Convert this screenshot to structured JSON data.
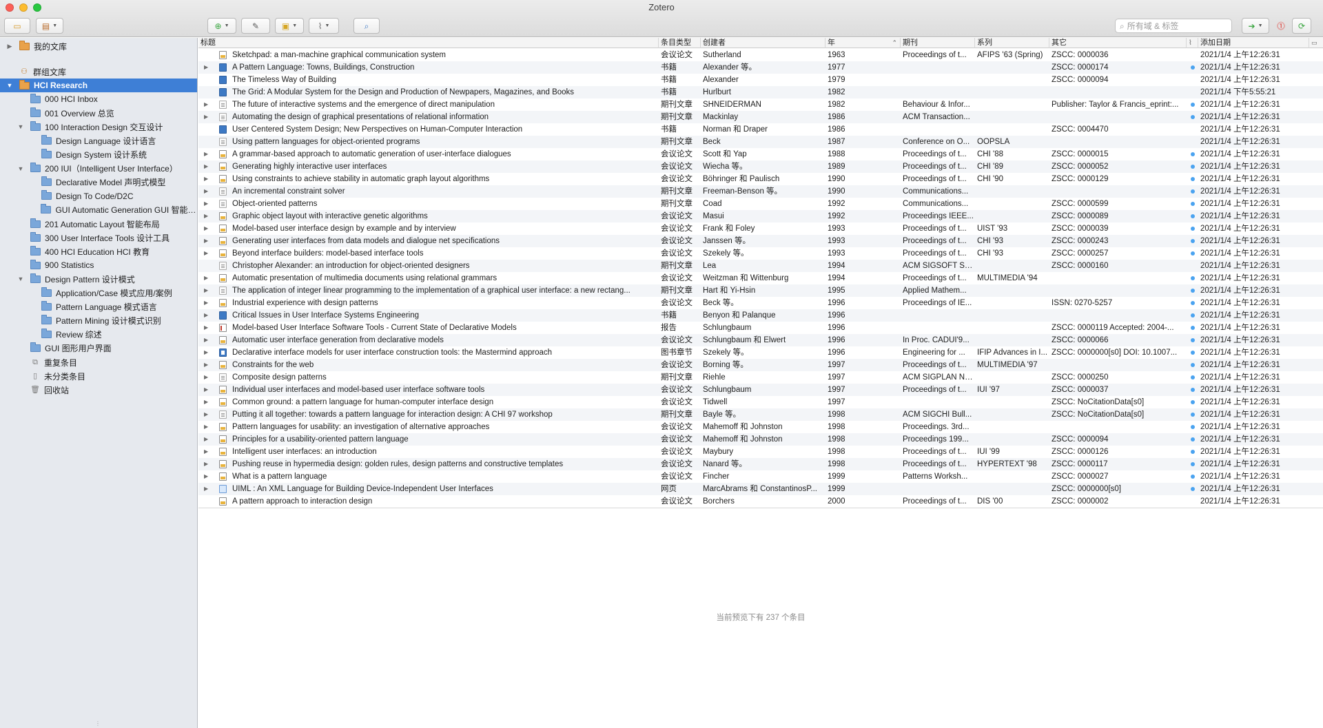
{
  "window": {
    "title": "Zotero"
  },
  "toolbar": {
    "search_placeholder": "所有域 & 标签",
    "search_value": ""
  },
  "sidebar": {
    "items": [
      {
        "label": "我的文库",
        "indent": 0,
        "twisty": "▶",
        "icon": "library-icon",
        "orange": true
      },
      {
        "label": "群组文库",
        "indent": 0,
        "twisty": "",
        "icon": "group-library-icon",
        "group": true
      },
      {
        "label": "HCI Research",
        "indent": 0,
        "twisty": "▼",
        "icon": "group-folder-icon",
        "orange": true,
        "selected": true
      },
      {
        "label": "000 HCI Inbox",
        "indent": 1,
        "twisty": ""
      },
      {
        "label": "001 Overview 总览",
        "indent": 1,
        "twisty": ""
      },
      {
        "label": "100 Interaction Design 交互设计",
        "indent": 1,
        "twisty": "▼"
      },
      {
        "label": "Design Language 设计语言",
        "indent": 2,
        "twisty": ""
      },
      {
        "label": "Design System 设计系统",
        "indent": 2,
        "twisty": ""
      },
      {
        "label": "200 IUI（Intelligent User Interface）",
        "indent": 1,
        "twisty": "▼"
      },
      {
        "label": "Declarative Model 声明式模型",
        "indent": 2,
        "twisty": ""
      },
      {
        "label": "Design To Code/D2C",
        "indent": 2,
        "twisty": ""
      },
      {
        "label": "GUI Automatic Generation GUI 智能生成",
        "indent": 2,
        "twisty": ""
      },
      {
        "label": "201 Automatic Layout 智能布局",
        "indent": 1,
        "twisty": ""
      },
      {
        "label": "300 User Interface Tools 设计工具",
        "indent": 1,
        "twisty": ""
      },
      {
        "label": "400 HCI Education HCI 教育",
        "indent": 1,
        "twisty": ""
      },
      {
        "label": "900 Statistics",
        "indent": 1,
        "twisty": ""
      },
      {
        "label": "Design Pattern 设计模式",
        "indent": 1,
        "twisty": "▼"
      },
      {
        "label": "Application/Case 模式应用/案例",
        "indent": 2,
        "twisty": ""
      },
      {
        "label": "Pattern Language 模式语言",
        "indent": 2,
        "twisty": ""
      },
      {
        "label": "Pattern Mining 设计模式识别",
        "indent": 2,
        "twisty": ""
      },
      {
        "label": "Review 综述",
        "indent": 2,
        "twisty": ""
      },
      {
        "label": "GUI 图形用户界面",
        "indent": 1,
        "twisty": ""
      },
      {
        "label": "重复条目",
        "indent": 1,
        "twisty": "",
        "special": "duplicate-items-icon"
      },
      {
        "label": "未分类条目",
        "indent": 1,
        "twisty": "",
        "special": "unfiled-items-icon"
      },
      {
        "label": "回收站",
        "indent": 1,
        "twisty": "",
        "special": "trash-icon"
      }
    ]
  },
  "columns": {
    "title": "标题",
    "type": "条目类型",
    "creator": "创建者",
    "year": "年",
    "publication": "期刊",
    "series": "系列",
    "extra": "其它",
    "date_added": "添加日期"
  },
  "rows": [
    {
      "title": "Sketchpad: a man-machine graphical communication system",
      "type": "会议论文",
      "creator": "Sutherland",
      "year": "1963",
      "pub": "Proceedings of t...",
      "series": "AFIPS '63 (Spring)",
      "extra": "ZSCC: 0000036",
      "added": "2021/1/4 上午12:26:31",
      "icon": "conf",
      "exp": false,
      "att": false
    },
    {
      "title": "A Pattern Language: Towns, Buildings, Construction",
      "type": "书籍",
      "creator": "Alexander 等。",
      "year": "1977",
      "pub": "",
      "series": "",
      "extra": "ZSCC: 0000174",
      "added": "2021/1/4 上午12:26:31",
      "icon": "book",
      "exp": true,
      "att": true
    },
    {
      "title": "The Timeless Way of Building",
      "type": "书籍",
      "creator": "Alexander",
      "year": "1979",
      "pub": "",
      "series": "",
      "extra": "ZSCC: 0000094",
      "added": "2021/1/4 上午12:26:31",
      "icon": "book",
      "exp": false,
      "att": false
    },
    {
      "title": "The Grid: A Modular System for the Design and Production of Newpapers, Magazines, and Books",
      "type": "书籍",
      "creator": "Hurlburt",
      "year": "1982",
      "pub": "",
      "series": "",
      "extra": "",
      "added": "2021/1/4 下午5:55:21",
      "icon": "book",
      "exp": false,
      "att": false
    },
    {
      "title": "The future of interactive systems and the emergence of direct manipulation",
      "type": "期刊文章",
      "creator": "SHNEIDERMAN",
      "year": "1982",
      "pub": "Behaviour & Infor...",
      "series": "",
      "extra": "Publisher: Taylor & Francis_eprint:...",
      "added": "2021/1/4 上午12:26:31",
      "icon": "journal",
      "exp": true,
      "att": true
    },
    {
      "title": "Automating the design of graphical presentations of relational information",
      "type": "期刊文章",
      "creator": "Mackinlay",
      "year": "1986",
      "pub": "ACM Transaction...",
      "series": "",
      "extra": "",
      "added": "2021/1/4 上午12:26:31",
      "icon": "journal",
      "exp": true,
      "att": true
    },
    {
      "title": "User Centered System Design; New Perspectives on Human-Computer Interaction",
      "type": "书籍",
      "creator": "Norman 和 Draper",
      "year": "1986",
      "pub": "",
      "series": "",
      "extra": "ZSCC: 0004470",
      "added": "2021/1/4 上午12:26:31",
      "icon": "book",
      "exp": false,
      "att": false
    },
    {
      "title": "Using pattern languages for object-oriented programs",
      "type": "期刊文章",
      "creator": "Beck",
      "year": "1987",
      "pub": "Conference on O...",
      "series": "OOPSLA",
      "extra": "",
      "added": "2021/1/4 上午12:26:31",
      "icon": "journal",
      "exp": false,
      "att": false
    },
    {
      "title": "A grammar-based approach to automatic generation of user-interface dialogues",
      "type": "会议论文",
      "creator": "Scott 和 Yap",
      "year": "1988",
      "pub": "Proceedings of t...",
      "series": "CHI '88",
      "extra": "ZSCC: 0000015",
      "added": "2021/1/4 上午12:26:31",
      "icon": "conf",
      "exp": true,
      "att": true
    },
    {
      "title": "Generating highly interactive user interfaces",
      "type": "会议论文",
      "creator": "Wiecha 等。",
      "year": "1989",
      "pub": "Proceedings of t...",
      "series": "CHI '89",
      "extra": "ZSCC: 0000052",
      "added": "2021/1/4 上午12:26:31",
      "icon": "conf",
      "exp": true,
      "att": true
    },
    {
      "title": "Using constraints to achieve stability in automatic graph layout algorithms",
      "type": "会议论文",
      "creator": "Böhringer 和 Paulisch",
      "year": "1990",
      "pub": "Proceedings of t...",
      "series": "CHI '90",
      "extra": "ZSCC: 0000129",
      "added": "2021/1/4 上午12:26:31",
      "icon": "conf",
      "exp": true,
      "att": true
    },
    {
      "title": "An incremental constraint solver",
      "type": "期刊文章",
      "creator": "Freeman-Benson 等。",
      "year": "1990",
      "pub": "Communications...",
      "series": "",
      "extra": "",
      "added": "2021/1/4 上午12:26:31",
      "icon": "journal",
      "exp": true,
      "att": true
    },
    {
      "title": "Object-oriented patterns",
      "type": "期刊文章",
      "creator": "Coad",
      "year": "1992",
      "pub": "Communications...",
      "series": "",
      "extra": "ZSCC: 0000599",
      "added": "2021/1/4 上午12:26:31",
      "icon": "journal",
      "exp": true,
      "att": true
    },
    {
      "title": "Graphic object layout with interactive genetic algorithms",
      "type": "会议论文",
      "creator": "Masui",
      "year": "1992",
      "pub": "Proceedings IEEE...",
      "series": "",
      "extra": "ZSCC: 0000089",
      "added": "2021/1/4 上午12:26:31",
      "icon": "conf",
      "exp": true,
      "att": true
    },
    {
      "title": "Model-based user interface design by example and by interview",
      "type": "会议论文",
      "creator": "Frank 和 Foley",
      "year": "1993",
      "pub": "Proceedings of t...",
      "series": "UIST '93",
      "extra": "ZSCC: 0000039",
      "added": "2021/1/4 上午12:26:31",
      "icon": "conf",
      "exp": true,
      "att": true
    },
    {
      "title": "Generating user interfaces from data models and dialogue net specifications",
      "type": "会议论文",
      "creator": "Janssen 等。",
      "year": "1993",
      "pub": "Proceedings of t...",
      "series": "CHI '93",
      "extra": "ZSCC: 0000243",
      "added": "2021/1/4 上午12:26:31",
      "icon": "conf",
      "exp": true,
      "att": true
    },
    {
      "title": "Beyond interface builders: model-based interface tools",
      "type": "会议论文",
      "creator": "Szekely 等。",
      "year": "1993",
      "pub": "Proceedings of t...",
      "series": "CHI '93",
      "extra": "ZSCC: 0000257",
      "added": "2021/1/4 上午12:26:31",
      "icon": "conf",
      "exp": true,
      "att": true
    },
    {
      "title": "Christopher Alexander: an introduction for object-oriented designers",
      "type": "期刊文章",
      "creator": "Lea",
      "year": "1994",
      "pub": "ACM SIGSOFT So...",
      "series": "",
      "extra": "ZSCC: 0000160",
      "added": "2021/1/4 上午12:26:31",
      "icon": "journal",
      "exp": false,
      "att": false
    },
    {
      "title": "Automatic presentation of multimedia documents using relational grammars",
      "type": "会议论文",
      "creator": "Weitzman 和 Wittenburg",
      "year": "1994",
      "pub": "Proceedings of t...",
      "series": "MULTIMEDIA '94",
      "extra": "",
      "added": "2021/1/4 上午12:26:31",
      "icon": "conf",
      "exp": true,
      "att": true
    },
    {
      "title": "The application of integer linear programming to the implementation of a graphical user interface: a new rectang...",
      "type": "期刊文章",
      "creator": "Hart 和 Yi-Hsin",
      "year": "1995",
      "pub": "Applied Mathem...",
      "series": "",
      "extra": "",
      "added": "2021/1/4 上午12:26:31",
      "icon": "journal",
      "exp": true,
      "att": true
    },
    {
      "title": "Industrial experience with design patterns",
      "type": "会议论文",
      "creator": "Beck 等。",
      "year": "1996",
      "pub": "Proceedings of IE...",
      "series": "",
      "extra": "ISSN: 0270-5257",
      "added": "2021/1/4 上午12:26:31",
      "icon": "conf",
      "exp": true,
      "att": true
    },
    {
      "title": "Critical Issues in User Interface Systems Engineering",
      "type": "书籍",
      "creator": "Benyon 和 Palanque",
      "year": "1996",
      "pub": "",
      "series": "",
      "extra": "",
      "added": "2021/1/4 上午12:26:31",
      "icon": "book",
      "exp": true,
      "att": true
    },
    {
      "title": "Model-based User Interface Software Tools - Current State of Declarative Models",
      "type": "报告",
      "creator": "Schlungbaum",
      "year": "1996",
      "pub": "",
      "series": "",
      "extra": "ZSCC: 0000119 Accepted: 2004-...",
      "added": "2021/1/4 上午12:26:31",
      "icon": "report",
      "exp": true,
      "att": true
    },
    {
      "title": "Automatic user interface generation from declarative models",
      "type": "会议论文",
      "creator": "Schlungbaum 和 Elwert",
      "year": "1996",
      "pub": "In Proc. CADUI'9...",
      "series": "",
      "extra": "ZSCC: 0000066",
      "added": "2021/1/4 上午12:26:31",
      "icon": "conf",
      "exp": true,
      "att": true
    },
    {
      "title": "Declarative interface models for user interface construction tools: the Mastermind approach",
      "type": "图书章节",
      "creator": "Szekely 等。",
      "year": "1996",
      "pub": "Engineering for ...",
      "series": "IFIP Advances in I...",
      "extra": "ZSCC: 0000000[s0] DOI: 10.1007...",
      "added": "2021/1/4 上午12:26:31",
      "icon": "chapter",
      "exp": true,
      "att": true
    },
    {
      "title": "Constraints for the web",
      "type": "会议论文",
      "creator": "Borning 等。",
      "year": "1997",
      "pub": "Proceedings of t...",
      "series": "MULTIMEDIA '97",
      "extra": "",
      "added": "2021/1/4 上午12:26:31",
      "icon": "conf",
      "exp": true,
      "att": true
    },
    {
      "title": "Composite design patterns",
      "type": "期刊文章",
      "creator": "Riehle",
      "year": "1997",
      "pub": "ACM SIGPLAN No...",
      "series": "",
      "extra": "ZSCC: 0000250",
      "added": "2021/1/4 上午12:26:31",
      "icon": "journal",
      "exp": true,
      "att": true
    },
    {
      "title": "Individual user interfaces and model-based user interface software tools",
      "type": "会议论文",
      "creator": "Schlungbaum",
      "year": "1997",
      "pub": "Proceedings of t...",
      "series": "IUI '97",
      "extra": "ZSCC: 0000037",
      "added": "2021/1/4 上午12:26:31",
      "icon": "conf",
      "exp": true,
      "att": true
    },
    {
      "title": "Common ground: a pattern language for human-computer interface design",
      "type": "会议论文",
      "creator": "Tidwell",
      "year": "1997",
      "pub": "",
      "series": "",
      "extra": "ZSCC: NoCitationData[s0]",
      "added": "2021/1/4 上午12:26:31",
      "icon": "conf",
      "exp": true,
      "att": true
    },
    {
      "title": "Putting it all together: towards a pattern language for interaction design: A CHI 97 workshop",
      "type": "期刊文章",
      "creator": "Bayle 等。",
      "year": "1998",
      "pub": "ACM SIGCHI Bull...",
      "series": "",
      "extra": "ZSCC: NoCitationData[s0]",
      "added": "2021/1/4 上午12:26:31",
      "icon": "journal",
      "exp": true,
      "att": true
    },
    {
      "title": "Pattern languages for usability: an investigation of alternative approaches",
      "type": "会议论文",
      "creator": "Mahemoff 和 Johnston",
      "year": "1998",
      "pub": "Proceedings. 3rd...",
      "series": "",
      "extra": "",
      "added": "2021/1/4 上午12:26:31",
      "icon": "conf",
      "exp": true,
      "att": true
    },
    {
      "title": "Principles for a usability-oriented pattern language",
      "type": "会议论文",
      "creator": "Mahemoff 和 Johnston",
      "year": "1998",
      "pub": "Proceedings 199...",
      "series": "",
      "extra": "ZSCC: 0000094",
      "added": "2021/1/4 上午12:26:31",
      "icon": "conf",
      "exp": true,
      "att": true
    },
    {
      "title": "Intelligent user interfaces: an introduction",
      "type": "会议论文",
      "creator": "Maybury",
      "year": "1998",
      "pub": "Proceedings of t...",
      "series": "IUI '99",
      "extra": "ZSCC: 0000126",
      "added": "2021/1/4 上午12:26:31",
      "icon": "conf",
      "exp": true,
      "att": true
    },
    {
      "title": "Pushing reuse in hypermedia design: golden rules, design patterns and constructive templates",
      "type": "会议论文",
      "creator": "Nanard 等。",
      "year": "1998",
      "pub": "Proceedings of t...",
      "series": "HYPERTEXT '98",
      "extra": "ZSCC: 0000117",
      "added": "2021/1/4 上午12:26:31",
      "icon": "conf",
      "exp": true,
      "att": true
    },
    {
      "title": "What is a pattern language",
      "type": "会议论文",
      "creator": "Fincher",
      "year": "1999",
      "pub": "Patterns Worksh...",
      "series": "",
      "extra": "ZSCC: 0000027",
      "added": "2021/1/4 上午12:26:31",
      "icon": "conf",
      "exp": true,
      "att": true
    },
    {
      "title": "UIML : An XML Language for Building Device-Independent User Interfaces",
      "type": "网页",
      "creator": "MarcAbrams 和 ConstantinosP...",
      "year": "1999",
      "pub": "",
      "series": "",
      "extra": "ZSCC: 0000000[s0]",
      "added": "2021/1/4 上午12:26:31",
      "icon": "web",
      "exp": true,
      "att": true
    },
    {
      "title": "A pattern approach to interaction design",
      "type": "会议论文",
      "creator": "Borchers",
      "year": "2000",
      "pub": "Proceedings of t...",
      "series": "DIS '00",
      "extra": "ZSCC: 0000002",
      "added": "2021/1/4 上午12:26:31",
      "icon": "conf",
      "exp": false,
      "att": false
    }
  ],
  "footer": {
    "message": "当前预览下有 237 个条目"
  },
  "colors": {
    "selection": "#3e7fd6",
    "sidebar_bg": "#e6e9ee",
    "attachment_dot": "#4aa3f0"
  }
}
